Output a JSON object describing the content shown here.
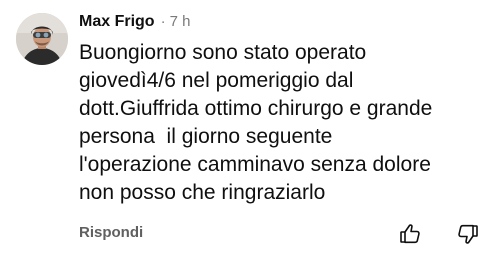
{
  "comment": {
    "author": "Max Frigo",
    "separator": "·",
    "time": "7 h",
    "lines": [
      "Buongiorno sono stato operato",
      "giovedì4/6 nel pomeriggio dal",
      "dott.Giuffrida ottimo chirurgo e grande",
      "persona  il giorno seguente",
      "l'operazione camminavo senza dolore",
      "non posso che ringraziarlo"
    ],
    "reply_label": "Rispondi"
  },
  "icons": {
    "like": "thumb-up-icon",
    "dislike": "thumb-down-icon",
    "avatar": "user-avatar"
  },
  "colors": {
    "text": "#0f0f0f",
    "secondary": "#606060",
    "meta": "#7a7a7a"
  }
}
